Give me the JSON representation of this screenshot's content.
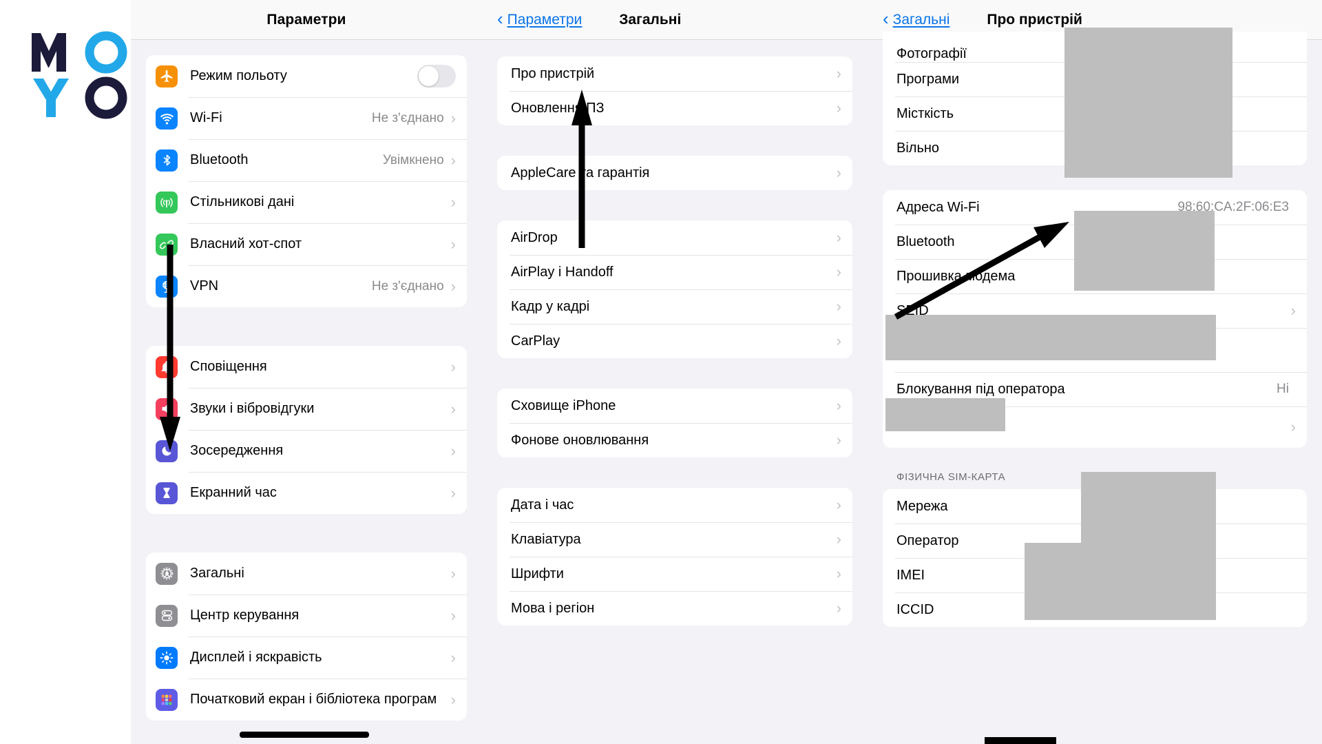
{
  "brand": {
    "name": "MOYO"
  },
  "left_panel": {
    "title": "Параметри",
    "groups": [
      {
        "items": [
          {
            "label": "Режим польоту",
            "icon": "airplane-icon",
            "icon_color": "#f79009",
            "control": "toggle",
            "value": ""
          },
          {
            "label": "Wi-Fi",
            "icon": "wifi-icon",
            "icon_color": "#0a84ff",
            "control": "chevron",
            "value": "Не з'єднано"
          },
          {
            "label": "Bluetooth",
            "icon": "bluetooth-icon",
            "icon_color": "#0a84ff",
            "control": "chevron",
            "value": "Увімкнено"
          },
          {
            "label": "Стільникові дані",
            "icon": "cellular-icon",
            "icon_color": "#34c759",
            "control": "chevron",
            "value": ""
          },
          {
            "label": "Власний хот-спот",
            "icon": "hotspot-icon",
            "icon_color": "#34c759",
            "control": "chevron",
            "value": ""
          },
          {
            "label": "VPN",
            "icon": "vpn-globe-icon",
            "icon_color": "#0a84ff",
            "control": "chevron",
            "value": "Не з'єднано"
          }
        ]
      },
      {
        "items": [
          {
            "label": "Сповіщення",
            "icon": "bell-icon",
            "icon_color": "#ff3b30",
            "control": "chevron",
            "value": ""
          },
          {
            "label": "Звуки і вібровідгуки",
            "icon": "speaker-icon",
            "icon_color": "#f43f5e",
            "control": "chevron",
            "value": ""
          },
          {
            "label": "Зосередження",
            "icon": "moon-icon",
            "icon_color": "#5856d6",
            "control": "chevron",
            "value": ""
          },
          {
            "label": "Екранний час",
            "icon": "hourglass-icon",
            "icon_color": "#5856d6",
            "control": "chevron",
            "value": ""
          }
        ]
      },
      {
        "items": [
          {
            "label": "Загальні",
            "icon": "gear-icon",
            "icon_color": "#8e8e93",
            "control": "chevron",
            "value": ""
          },
          {
            "label": "Центр керування",
            "icon": "control-center-icon",
            "icon_color": "#8e8e93",
            "control": "chevron",
            "value": ""
          },
          {
            "label": "Дисплей і яскравість",
            "icon": "brightness-icon",
            "icon_color": "#007aff",
            "control": "chevron",
            "value": ""
          },
          {
            "label": "Початковий екран і бібліотека програм",
            "icon": "app-library-icon",
            "icon_color": "#5e5ce6",
            "control": "chevron",
            "value": ""
          }
        ]
      }
    ]
  },
  "mid_panel": {
    "back_label": "Параметри",
    "title": "Загальні",
    "groups": [
      {
        "items": [
          {
            "label": "Про пристрій"
          },
          {
            "label": "Оновлення ПЗ"
          }
        ]
      },
      {
        "items": [
          {
            "label": "AppleCare та гарантія"
          }
        ]
      },
      {
        "items": [
          {
            "label": "AirDrop"
          },
          {
            "label": "AirPlay і Handoff"
          },
          {
            "label": "Кадр у кадрі"
          },
          {
            "label": "CarPlay"
          }
        ]
      },
      {
        "items": [
          {
            "label": "Сховище iPhone"
          },
          {
            "label": "Фонове оновлювання"
          }
        ]
      },
      {
        "items": [
          {
            "label": "Дата і час"
          },
          {
            "label": "Клавіатура"
          },
          {
            "label": "Шрифти"
          },
          {
            "label": "Мова і регіон"
          }
        ]
      }
    ]
  },
  "right_panel": {
    "back_label": "Загальні",
    "title": "Про пристрій",
    "groups": [
      {
        "items": [
          {
            "label": "Фотографії",
            "value": "",
            "redacted": true
          },
          {
            "label": "Програми",
            "value": "",
            "redacted": true
          },
          {
            "label": "Місткість",
            "value": "",
            "redacted": true
          },
          {
            "label": "Вільно",
            "value": "",
            "redacted": true
          }
        ]
      },
      {
        "items": [
          {
            "label": "Адреса Wi-Fi",
            "value": "98:60:CA:2F:06:E3",
            "redacted": false
          },
          {
            "label": "Bluetooth",
            "value": "",
            "redacted": true
          },
          {
            "label": "Прошивка модема",
            "value": "",
            "redacted": true
          },
          {
            "label": "SEID",
            "value": "",
            "redacted": false,
            "chevron": true
          },
          {
            "label": "",
            "value": "",
            "redacted": true
          },
          {
            "label": "Блокування під оператора",
            "value": "Ні",
            "redacted": false
          },
          {
            "label": "",
            "value": "",
            "redacted": true,
            "chevron": true
          }
        ]
      }
    ],
    "sim_section_header": "ФІЗИЧНА SIM-КАРТА",
    "sim_items": [
      {
        "label": "Мережа",
        "value": "",
        "redacted": true
      },
      {
        "label": "Оператор",
        "value": "",
        "redacted": true
      },
      {
        "label": "IMEI",
        "value": "",
        "redacted": true
      },
      {
        "label": "ICCID",
        "value": "",
        "redacted": true
      }
    ]
  },
  "annotations": {
    "arrow_to_general": "arrow-down-to-general",
    "arrow_to_about": "arrow-up-to-about",
    "arrow_to_wifi_address": "arrow-to-wifi-address",
    "underline_home_screen": "underline-home-screen-row"
  },
  "colors": {
    "accent_blue": "#0a74e8",
    "panel_bg": "#f2f2f7",
    "card_bg": "#ffffff",
    "separator": "#e4e4e6",
    "secondary_text": "#8a8a8e",
    "redaction": "#bebebe",
    "logo_dark": "#1d1b3a",
    "logo_cyan": "#22a8e8"
  }
}
